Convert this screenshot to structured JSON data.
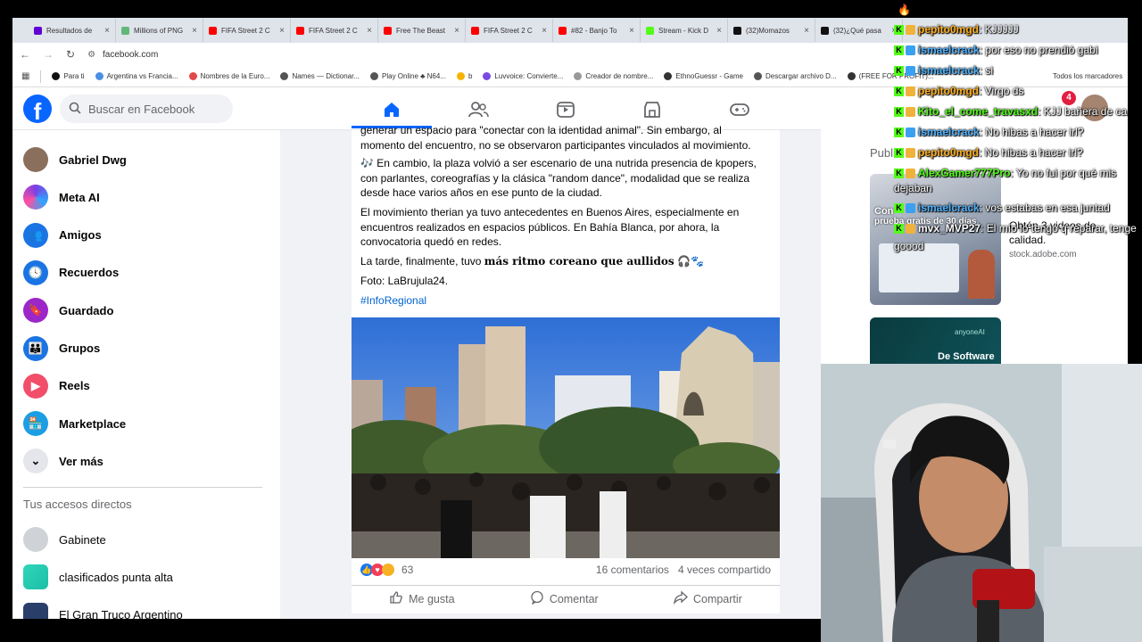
{
  "browser": {
    "tabs": [
      {
        "title": "Resultados de",
        "color": "#6001d2"
      },
      {
        "title": "Millions of PNG",
        "color": "#5fb878"
      },
      {
        "title": "FIFA Street 2 C",
        "color": "#ff0000"
      },
      {
        "title": "FIFA Street 2 C",
        "color": "#ff0000"
      },
      {
        "title": "Free The Beast",
        "color": "#ff0000"
      },
      {
        "title": "FIFA Street 2 C",
        "color": "#ff0000"
      },
      {
        "title": "#82 - Banjo To",
        "color": "#ff0000"
      },
      {
        "title": "Stream - Kick D",
        "color": "#53fc18"
      },
      {
        "title": "(32)Momazos",
        "color": "#111111"
      },
      {
        "title": "(32)¿Qué pasa",
        "color": "#111111"
      }
    ],
    "url": "facebook.com",
    "bookmarks": [
      {
        "label": "Para ti"
      },
      {
        "label": "Argentina vs Francia..."
      },
      {
        "label": "Nombres de la Euro..."
      },
      {
        "label": "Names — Dictionar..."
      },
      {
        "label": "Play Online ♣ N64..."
      },
      {
        "label": "b"
      },
      {
        "label": "Luvvoice: Convierte..."
      },
      {
        "label": "Creador de nombre..."
      },
      {
        "label": "EthnoGuessr - Game"
      },
      {
        "label": "Descargar archivo D..."
      },
      {
        "label": "(FREE FOR PROFIT)..."
      }
    ],
    "bookmarks_all": "Todos los marcadores"
  },
  "facebook": {
    "search_placeholder": "Buscar en Facebook",
    "notification_count": "4",
    "sidebar": [
      {
        "label": "Gabriel Dwg",
        "icon": "profile-avatar"
      },
      {
        "label": "Meta AI",
        "icon": "meta-ai-icon"
      },
      {
        "label": "Amigos",
        "icon": "friends-icon"
      },
      {
        "label": "Recuerdos",
        "icon": "memories-icon"
      },
      {
        "label": "Guardado",
        "icon": "saved-icon"
      },
      {
        "label": "Grupos",
        "icon": "groups-icon"
      },
      {
        "label": "Reels",
        "icon": "reels-icon"
      },
      {
        "label": "Marketplace",
        "icon": "marketplace-icon"
      },
      {
        "label": "Ver más",
        "icon": "chevron-down-icon"
      }
    ],
    "shortcuts_title": "Tus accesos directos",
    "shortcuts": [
      {
        "label": "Gabinete"
      },
      {
        "label": "clasificados punta alta"
      },
      {
        "label": "El Gran Truco Argentino"
      }
    ],
    "post": {
      "p0": "generar un espacio para \"conectar con la identidad animal\". Sin embargo, al momento del encuentro, no se observaron participantes vinculados al movimiento.",
      "p1": "🎶 En cambio, la plaza volvió a ser escenario de una nutrida presencia de kpopers, con parlantes, coreografías y la clásica \"random dance\", modalidad que se realiza desde hace varios años en ese punto de la ciudad.",
      "p2": "El movimiento therian ya tuvo antecedentes en Buenos Aires, especialmente en encuentros realizados en espacios públicos. En Bahía Blanca, por ahora, la convocatoria quedó en redes.",
      "p3_plain": "La tarde, finalmente, tuvo ",
      "p3_bold": "más ritmo coreano que aullidos",
      "p3_emoji": " 🎧🐾",
      "p4": "Foto: LaBrujula24.",
      "hashtag": "#InfoRegional",
      "reaction_count": "63",
      "comments": "16 comentarios",
      "shares": "4 veces compartido",
      "like_label": "Me gusta",
      "comment_label": "Comentar",
      "share_label": "Compartir"
    },
    "right": {
      "sponsored_partial": "Publi",
      "ad1_overlay_1": "Con",
      "ad1_overlay_2": "prueba gratis de 30 días.",
      "ad1_title": "Obtén 3 videos de calidad.",
      "ad1_url": "stock.adobe.com",
      "ad2_brand": "anyoneAI",
      "ad2_title": "De Software"
    }
  },
  "chat": [
    {
      "user": "pepito0mgd",
      "msg": ": KJJJJJ",
      "color": "#ffb020"
    },
    {
      "user": "ismaelcrack",
      "msg": ": por eso no prendió gabi",
      "color": "#4fb3ff"
    },
    {
      "user": "ismaelcrack",
      "msg": ": si",
      "color": "#4fb3ff"
    },
    {
      "user": "pepito0mgd",
      "msg": ": Virgo ds",
      "color": "#ffb020"
    },
    {
      "user": "Kito_el_come_travasxd",
      "msg": ": KJJ bañera de ca",
      "color": "#53fc18"
    },
    {
      "user": "ismaelcrack",
      "msg": ": No hibas a hacer irl?",
      "color": "#4fb3ff"
    },
    {
      "user": "pepito0mgd",
      "msg": ": No hibas a hacer irl?",
      "color": "#ffb020"
    },
    {
      "user": "AlexGamer777Pro",
      "msg": ": Yo no fui por qué mis",
      "color": "#53fc18"
    },
    {
      "user": "",
      "msg": "dejaban",
      "color": "#ffffff"
    },
    {
      "user": "ismaelcrack",
      "msg": ": vos estabas en esa juntad",
      "color": "#4fb3ff"
    },
    {
      "user": "mvx_MVP27",
      "msg": ": El mío lo tengo q reparar, tenge",
      "color": "#ffffff"
    },
    {
      "user": "",
      "msg": "goood",
      "color": "#ffffff"
    }
  ]
}
